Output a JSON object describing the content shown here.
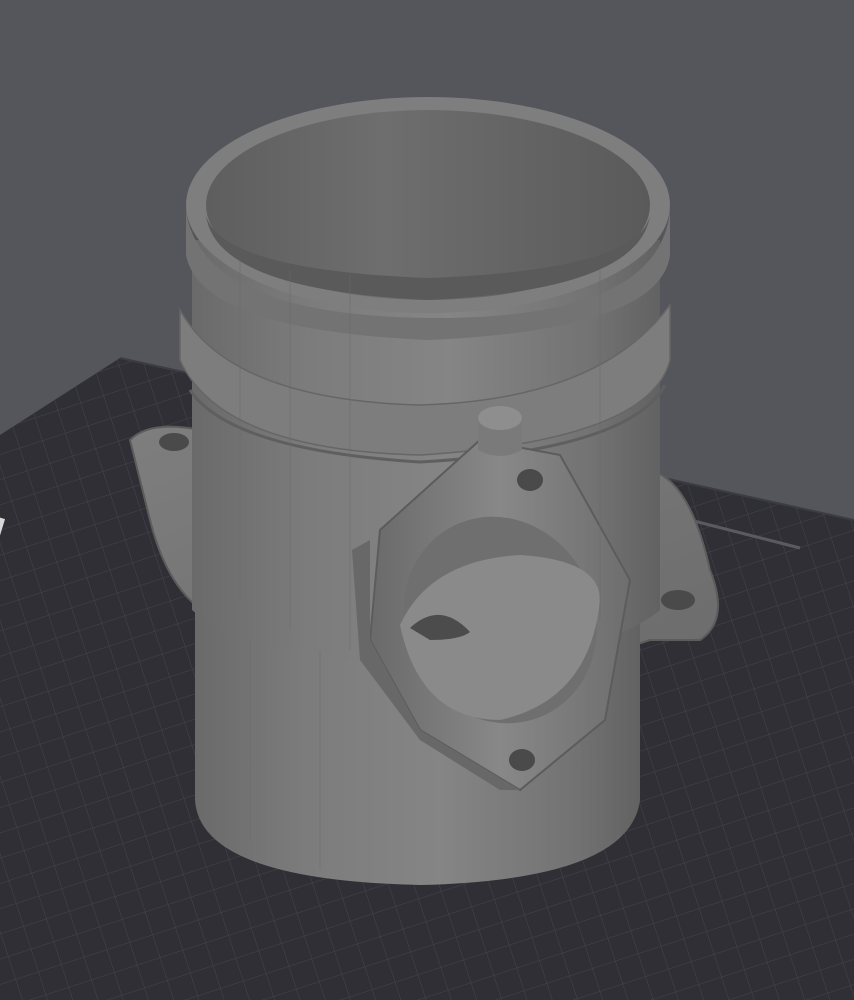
{
  "viewport": {
    "background_color": "#55555c",
    "bed_color": "#2f2f35",
    "grid_color": "#45454c",
    "model_color": "#7a7a7a"
  },
  "build_plate": {
    "brand_label": "Bambu",
    "label_color": "#d8d8d8"
  },
  "model": {
    "name_icon": "mass-air-flow-housing-model",
    "flange_holes": 4
  }
}
